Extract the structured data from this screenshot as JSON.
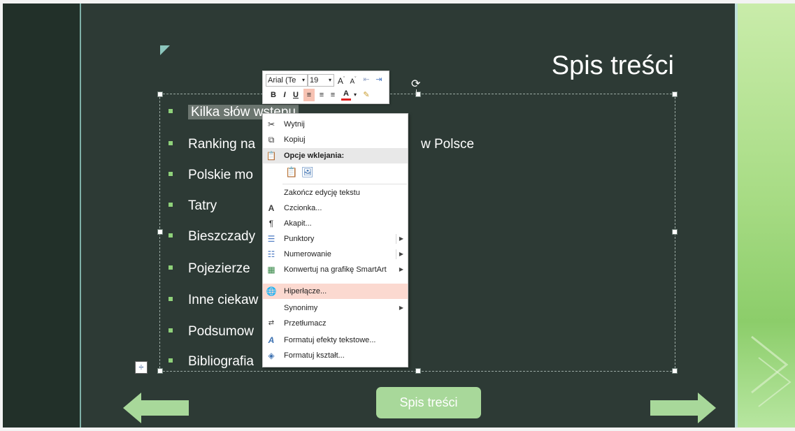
{
  "slide": {
    "title": "Spis treści",
    "items": [
      "Kilka słów wstępu",
      "Ranking na",
      "w Polsce",
      "Polskie mo",
      "Tatry",
      "Bieszczady",
      "Pojezierze",
      "Inne ciekaw",
      "Podsumow",
      "Bibliografia"
    ],
    "nav_center_label": "Spis treści",
    "colors": {
      "slide_bg": "#2d3a35",
      "accent_green": "#8fd17a",
      "button_green": "#a8d89a"
    }
  },
  "mini_toolbar": {
    "font_name": "Arial (Te",
    "font_size": "19",
    "grow_font": "A",
    "shrink_font": "A",
    "bold": "B",
    "italic": "I",
    "underline": "U",
    "font_color": "A"
  },
  "context_menu": {
    "items": [
      {
        "label": "Wytnij",
        "icon": "scissors-icon"
      },
      {
        "label": "Kopiuj",
        "icon": "copy-icon"
      },
      {
        "label": "Opcje wklejania:",
        "icon": "paste-icon"
      },
      {
        "label": "Zakończ edycję tekstu",
        "icon": ""
      },
      {
        "label": "Czcionka...",
        "icon": "font-icon"
      },
      {
        "label": "Akapit...",
        "icon": "paragraph-icon"
      },
      {
        "label": "Punktory",
        "icon": "bullets-icon"
      },
      {
        "label": "Numerowanie",
        "icon": "numbering-icon"
      },
      {
        "label": "Konwertuj na grafikę SmartArt",
        "icon": "smartart-icon"
      },
      {
        "label": "Hiperłącze...",
        "icon": "hyperlink-icon"
      },
      {
        "label": "Synonimy",
        "icon": ""
      },
      {
        "label": "Przetłumacz",
        "icon": "translate-icon"
      },
      {
        "label": "Formatuj efekty tekstowe...",
        "icon": "text-effects-icon"
      },
      {
        "label": "Formatuj kształt...",
        "icon": "format-shape-icon"
      }
    ]
  }
}
